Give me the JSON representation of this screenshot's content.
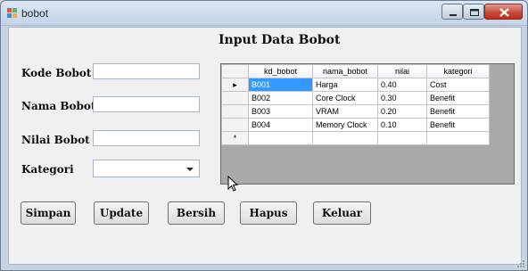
{
  "window": {
    "title": "bobot",
    "icon": "app-icon"
  },
  "form": {
    "title": "Input Data Bobot",
    "fields": {
      "kode_label": "Kode Bobot",
      "kode_value": "",
      "nama_label": "Nama Bobot",
      "nama_value": "",
      "nilai_label": "Nilai Bobot",
      "nilai_value": "",
      "kategori_label": "Kategori",
      "kategori_value": ""
    }
  },
  "grid": {
    "columns": [
      "kd_bobot",
      "nama_bobot",
      "nilai",
      "kategori"
    ],
    "rows": [
      [
        "B001",
        "Harga",
        "0.40",
        "Cost"
      ],
      [
        "B002",
        "Core Clock",
        "0.30",
        "Benefit"
      ],
      [
        "B003",
        "VRAM",
        "0.20",
        "Benefit"
      ],
      [
        "B004",
        "Memory Clock",
        "0.10",
        "Benefit"
      ]
    ],
    "current_row_marker": "▸",
    "new_row_marker": "*"
  },
  "buttons": {
    "simpan": "Simpan",
    "update": "Update",
    "bersih": "Bersih",
    "hapus": "Hapus",
    "keluar": "Keluar"
  },
  "colors": {
    "selection": "#3399ff",
    "close_button": "#c7493a"
  }
}
